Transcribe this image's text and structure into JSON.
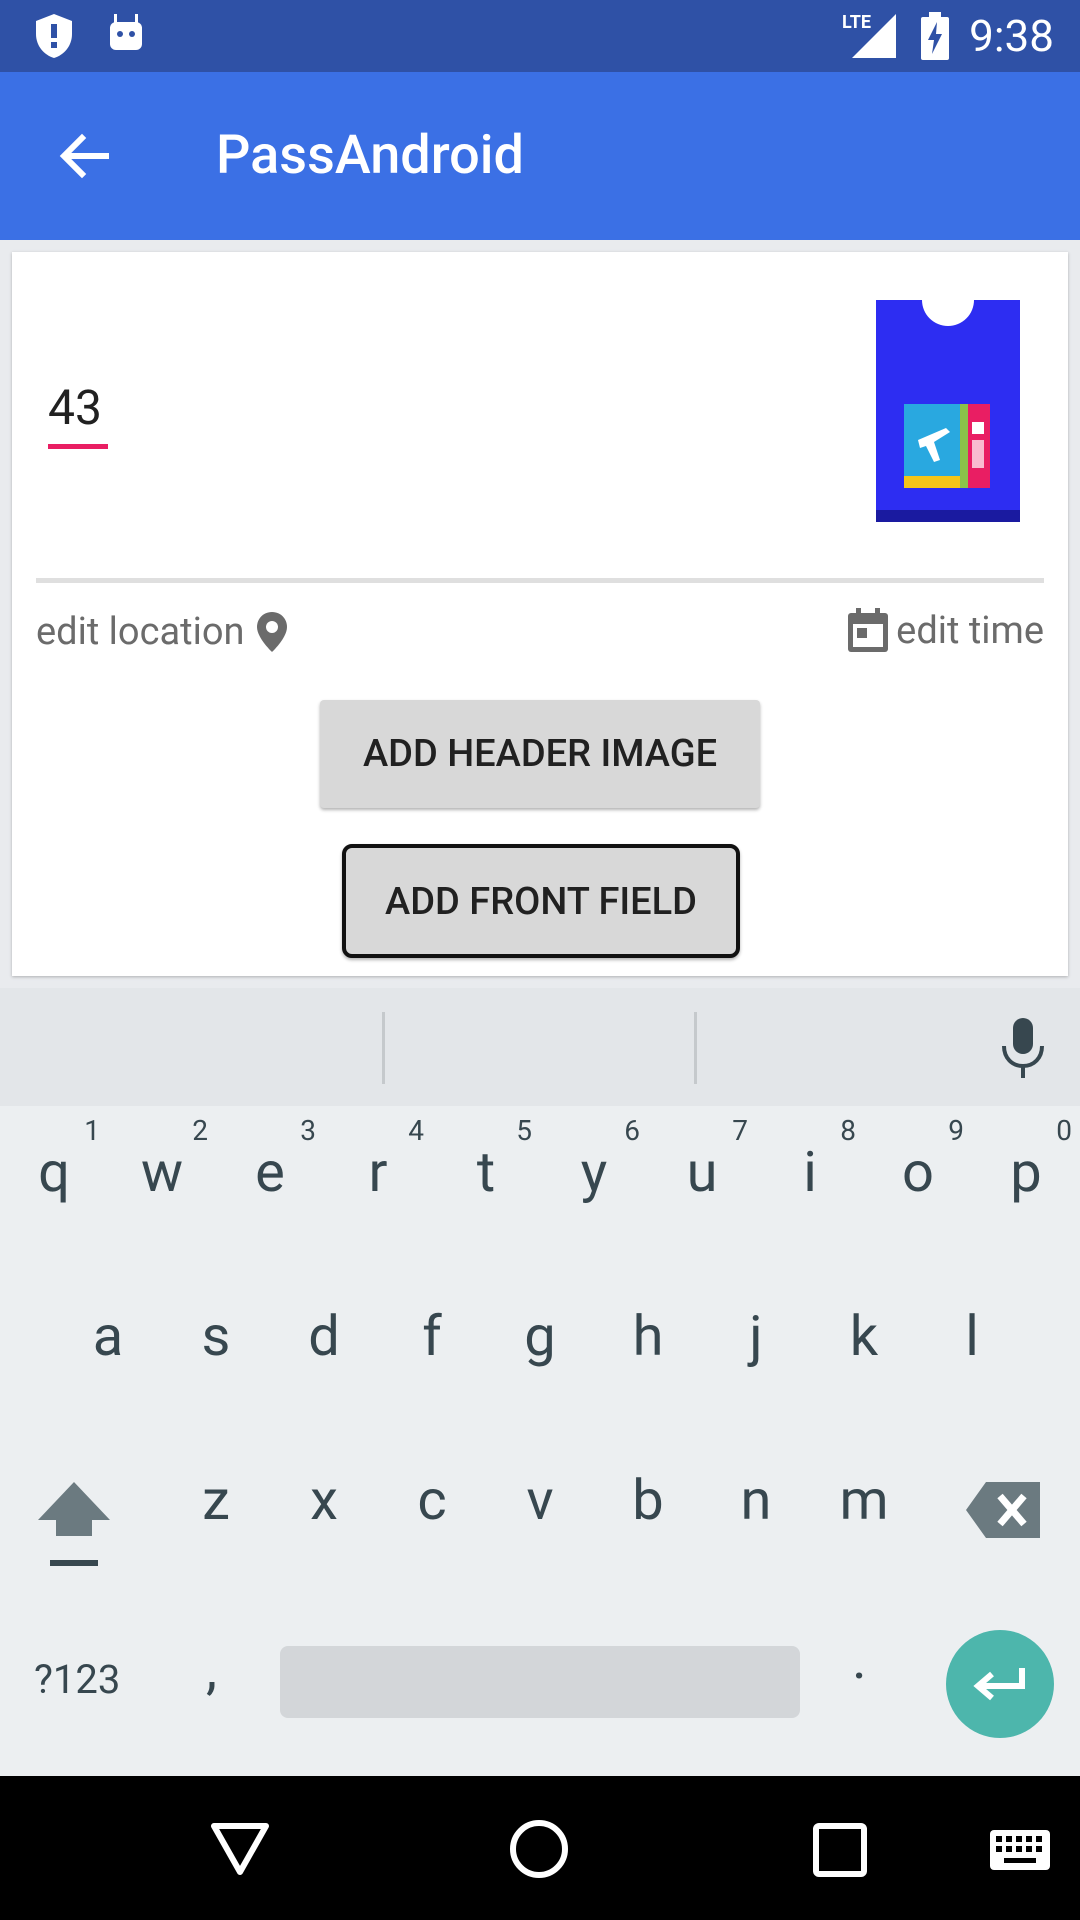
{
  "status_bar": {
    "time": "9:38",
    "network": "LTE",
    "icons": [
      "shield-icon",
      "android-icon",
      "signal-icon",
      "battery-charging-icon"
    ]
  },
  "app_bar": {
    "title": "PassAndroid",
    "back_icon": "arrow-back-icon"
  },
  "card": {
    "field_value": "43",
    "pass_icon": "boarding-pass-icon",
    "edit_location_label": "edit location",
    "edit_time_label": "edit time",
    "add_header_image_label": "ADD HEADER IMAGE",
    "add_front_field_label": "ADD FRONT FIELD"
  },
  "keyboard": {
    "row1": [
      {
        "ch": "q",
        "hint": "1"
      },
      {
        "ch": "w",
        "hint": "2"
      },
      {
        "ch": "e",
        "hint": "3"
      },
      {
        "ch": "r",
        "hint": "4"
      },
      {
        "ch": "t",
        "hint": "5"
      },
      {
        "ch": "y",
        "hint": "6"
      },
      {
        "ch": "u",
        "hint": "7"
      },
      {
        "ch": "i",
        "hint": "8"
      },
      {
        "ch": "o",
        "hint": "9"
      },
      {
        "ch": "p",
        "hint": "0"
      }
    ],
    "row2": [
      "a",
      "s",
      "d",
      "f",
      "g",
      "h",
      "j",
      "k",
      "l"
    ],
    "row3": [
      "z",
      "x",
      "c",
      "v",
      "b",
      "n",
      "m"
    ],
    "symbols_label": "?123",
    "comma": ",",
    "period": ".",
    "accent_color": "#4db6ac"
  },
  "colors": {
    "status_bar": "#2f51a6",
    "app_bar": "#3b70e5",
    "field_underline": "#e91e63"
  }
}
